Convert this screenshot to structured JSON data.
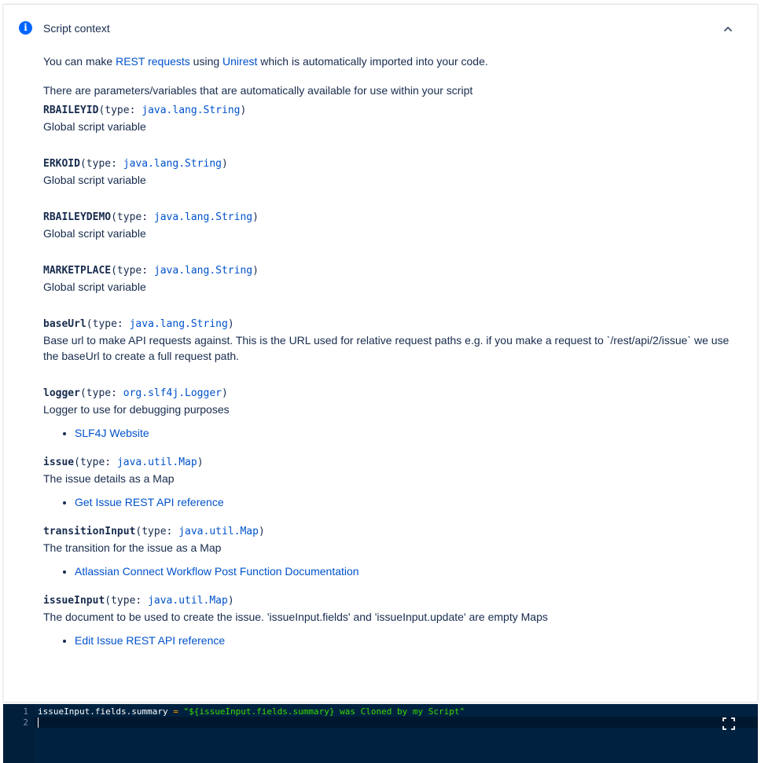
{
  "panel": {
    "title": "Script context",
    "info_icon": "info-icon",
    "collapse_icon": "chevron-up-icon"
  },
  "intro": {
    "prefix": "You can make ",
    "rest_link": "REST requests",
    "middle": " using ",
    "unirest_link": "Unirest",
    "suffix": " which is automatically imported into your code."
  },
  "params_intro": "There are parameters/variables that are automatically available for use within your script",
  "variables": [
    {
      "name": "RBAILEYID",
      "type_prefix": "(type: ",
      "type": "java.lang.String",
      "type_suffix": ")",
      "desc": "Global script variable"
    },
    {
      "name": "ERKOID",
      "type_prefix": "(type: ",
      "type": "java.lang.String",
      "type_suffix": ")",
      "desc": "Global script variable"
    },
    {
      "name": "RBAILEYDEMO",
      "type_prefix": "(type: ",
      "type": "java.lang.String",
      "type_suffix": ")",
      "desc": "Global script variable"
    },
    {
      "name": "MARKETPLACE",
      "type_prefix": "(type: ",
      "type": "java.lang.String",
      "type_suffix": ")",
      "desc": "Global script variable"
    },
    {
      "name": "baseUrl",
      "type_prefix": "(type: ",
      "type": "java.lang.String",
      "type_suffix": ")",
      "desc": "Base url to make API requests against. This is the URL used for relative request paths e.g. if you make a request to `/rest/api/2/issue` we use the baseUrl to create a full request path."
    },
    {
      "name": "logger",
      "type_prefix": "(type: ",
      "type": "org.slf4j.Logger",
      "type_suffix": ")",
      "desc": "Logger to use for debugging purposes",
      "link": "SLF4J Website"
    },
    {
      "name": "issue",
      "type_prefix": "(type: ",
      "type": "java.util.Map",
      "type_suffix": ")",
      "desc": "The issue details as a Map",
      "link": "Get Issue REST API reference"
    },
    {
      "name": "transitionInput",
      "type_prefix": "(type: ",
      "type": "java.util.Map",
      "type_suffix": ")",
      "desc": "The transition for the issue as a Map",
      "link": "Atlassian Connect Workflow Post Function Documentation"
    },
    {
      "name": "issueInput",
      "type_prefix": "(type: ",
      "type": "java.util.Map",
      "type_suffix": ")",
      "desc": "The document to be used to create the issue. 'issueInput.fields' and 'issueInput.update' are empty Maps",
      "link": "Edit Issue REST API reference"
    }
  ],
  "editor": {
    "line_numbers": [
      "1",
      "2"
    ],
    "line1_lhs": "issueInput.fields.summary",
    "line1_op": " = ",
    "line1_str": "\"${issueInput.fields.summary} was Cloned by my Script\"",
    "fullscreen_icon": "fullscreen-icon"
  },
  "colors": {
    "link": "#0052cc",
    "text": "#172b4d",
    "info_icon": "#0065ff",
    "editor_bg": "#002240",
    "string": "#3ad900",
    "operator": "#ff9d00"
  }
}
